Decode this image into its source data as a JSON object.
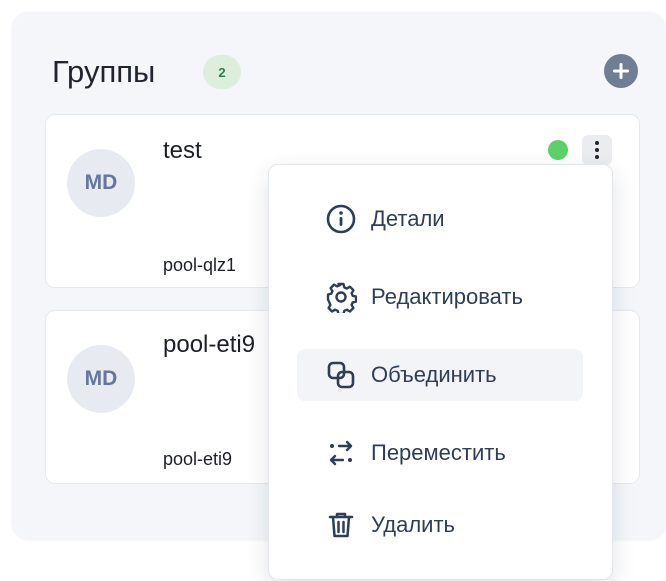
{
  "groups": {
    "title": "Группы",
    "count": "2"
  },
  "cards": [
    {
      "initials": "MD",
      "name": "test",
      "pool": "pool-qlz1",
      "status_color": "#5cd16a"
    },
    {
      "initials": "MD",
      "name": "pool-eti9",
      "pool": "pool-eti9"
    }
  ],
  "menu": {
    "details": "Детали",
    "edit": "Редактировать",
    "merge": "Объединить",
    "move": "Переместить",
    "delete": "Удалить"
  },
  "icons": {
    "add": "plus-circle-icon",
    "more": "kebab-menu-icon",
    "details": "info-icon",
    "edit": "gear-icon",
    "merge": "merge-icon",
    "move": "move-arrows-icon",
    "delete": "trash-icon"
  },
  "colors": {
    "accent": "#6f7e95",
    "status_online": "#5cd16a",
    "menu_text": "#2f3d57"
  }
}
